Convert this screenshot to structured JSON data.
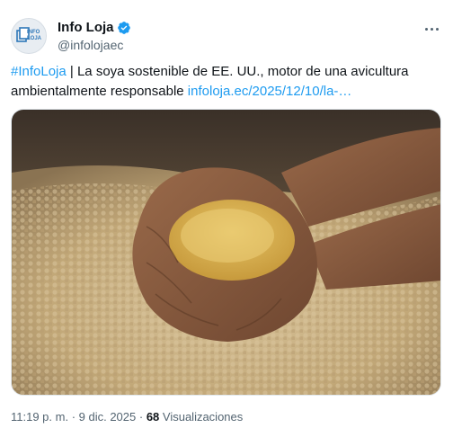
{
  "author": {
    "display_name": "Info Loja",
    "handle": "@infolojaec",
    "avatar_text_line1": "INFO",
    "avatar_text_line2": "LOJA",
    "verified_color": "#1d9bf0"
  },
  "post": {
    "hashtag": "#InfoLoja",
    "separator": " | ",
    "body": "La soya sostenible de EE. UU., motor de una avicultura ambientalmente responsable ",
    "link": "infoloja.ec/2025/12/10/la-…",
    "media_icon": "photo-cupped-hands-soybean-meal"
  },
  "meta": {
    "time": "11:19 p. m.",
    "dot1": " · ",
    "date": "9 dic. 2025",
    "dot2": " · ",
    "views_count": "68",
    "views_label": " Visualizaciones"
  },
  "more_icon": "ellipsis-icon",
  "colors": {
    "accent": "#1d9bf0",
    "secondary_text": "#536471",
    "primary_text": "#0f1419"
  }
}
